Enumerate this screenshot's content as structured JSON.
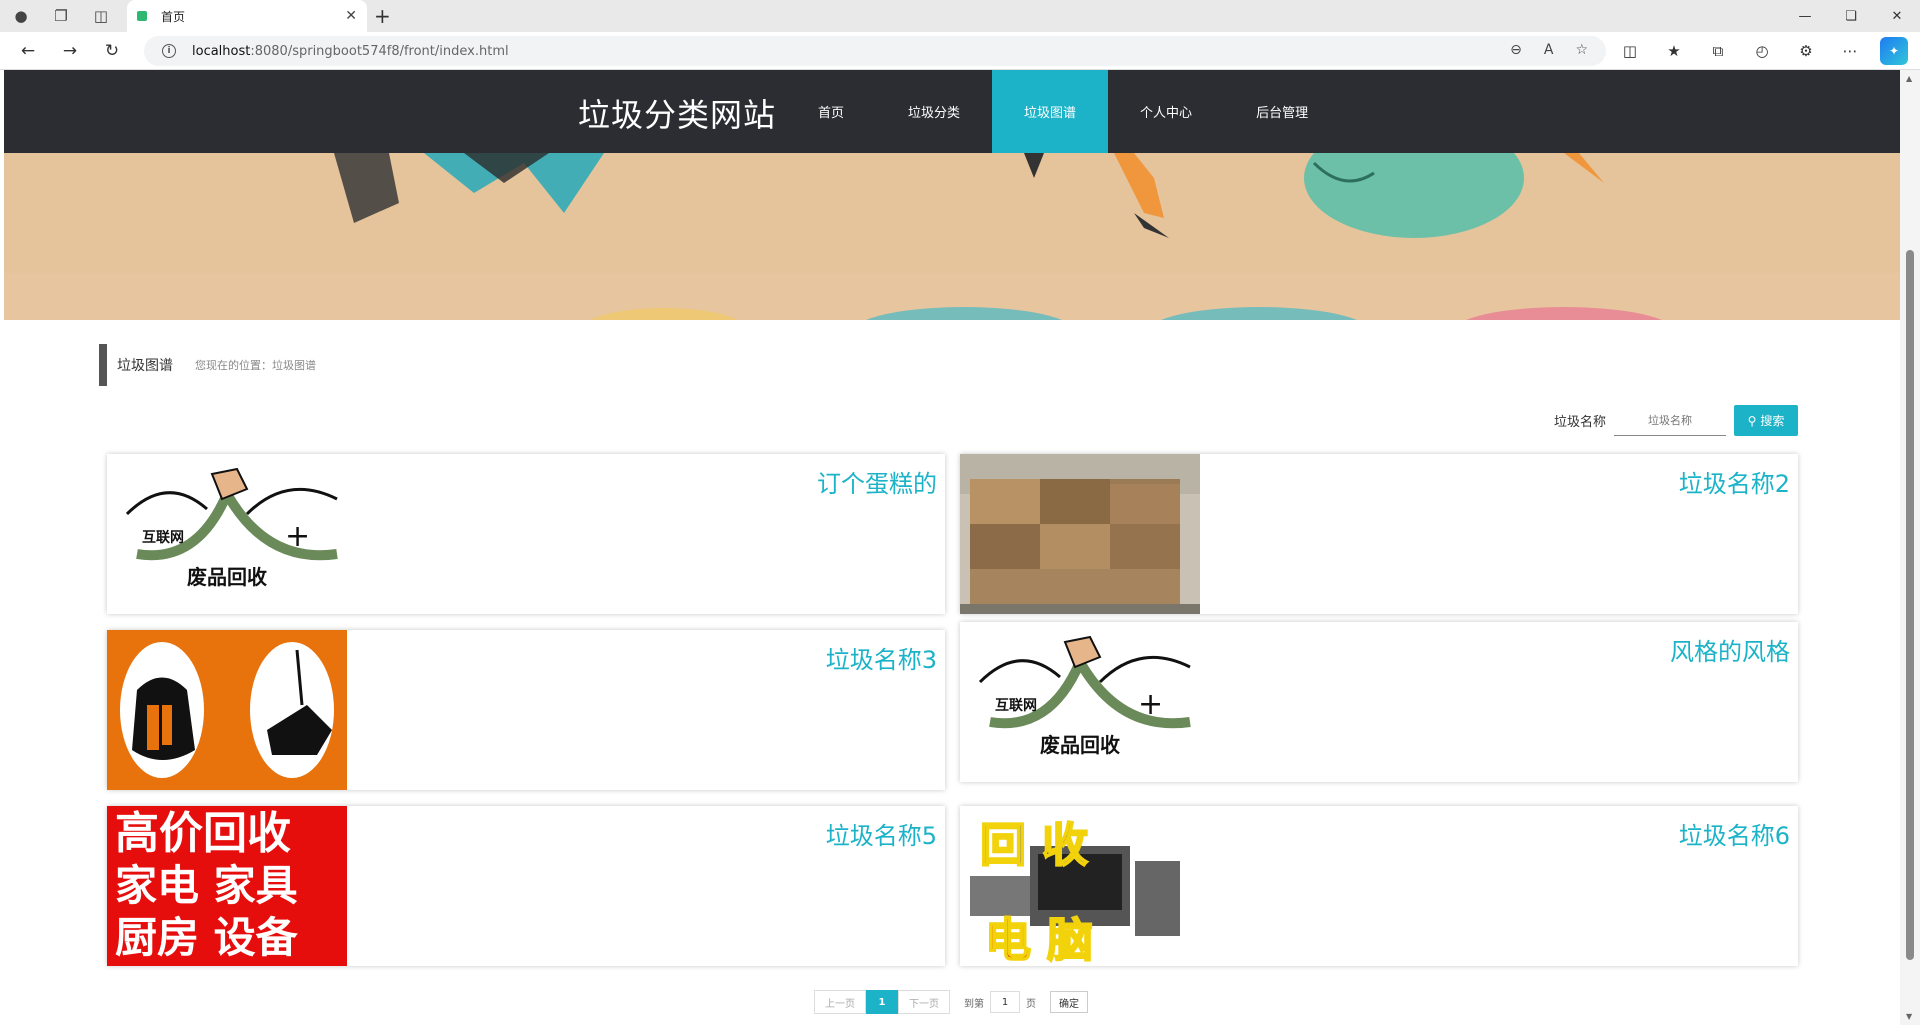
{
  "browser": {
    "tab_title": "首页",
    "url_host": "localhost",
    "url_path": ":8080/springboot574f8/front/index.html"
  },
  "site": {
    "brand": "垃圾分类网站",
    "menu": [
      {
        "label": "首页",
        "active": false
      },
      {
        "label": "垃圾分类",
        "active": false
      },
      {
        "label": "垃圾图谱",
        "active": true
      },
      {
        "label": "个人中心",
        "active": false
      },
      {
        "label": "后台管理",
        "active": false
      }
    ],
    "accent_color": "#1cb3c8",
    "header_color": "#2b2d33"
  },
  "page": {
    "section_title": "垃圾图谱",
    "breadcrumb": "您现在的位置：垃圾图谱",
    "search_label": "垃圾名称",
    "search_placeholder": "垃圾名称",
    "search_button": "搜索"
  },
  "cards": [
    {
      "name": "订个蛋糕的",
      "image": "waste-recycling-logo"
    },
    {
      "name": "垃圾名称2",
      "image": "cardboard-bales-photo"
    },
    {
      "name": "垃圾名称3",
      "image": "clothes-shoes-recycling"
    },
    {
      "name": "风格的风格",
      "image": "waste-recycling-logo"
    },
    {
      "name": "垃圾名称5",
      "image": "high-price-recycling-sign"
    },
    {
      "name": "垃圾名称6",
      "image": "computer-recycling-sign"
    }
  ],
  "image_text": {
    "logo_internet": "互联网",
    "logo_plus": "+",
    "logo_text": "废品回收",
    "sign_line1": "高价回收",
    "sign_line2": "家电 家具",
    "sign_line3": "厨房 设备",
    "computer_top": "回 收",
    "computer_bottom": "电 脑"
  },
  "pagination": {
    "prev": "上一页",
    "current": "1",
    "next": "下一页",
    "goto_label": "到第",
    "page_input": "1",
    "page_unit": "页",
    "confirm": "确定"
  }
}
